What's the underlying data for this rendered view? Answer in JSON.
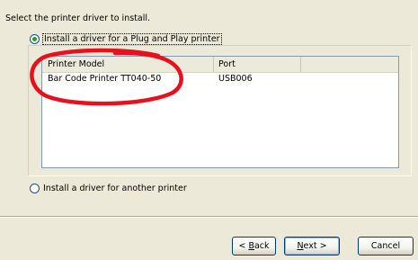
{
  "instruction": "Select the printer driver to install.",
  "options": {
    "plug_and_play": {
      "label": "Install a driver for a Plug and Play printer",
      "selected": true
    },
    "another": {
      "label": "Install a driver for another printer",
      "selected": false
    }
  },
  "printer_list": {
    "columns": [
      "Printer Model",
      "Port",
      ""
    ],
    "rows": [
      {
        "model": "Bar Code Printer TT040-50",
        "port": "USB006"
      }
    ]
  },
  "buttons": {
    "back": {
      "prefix": "< ",
      "underline": "B",
      "rest": "ack"
    },
    "next": {
      "underline": "N",
      "rest": "ext >"
    },
    "cancel": {
      "label": "Cancel"
    }
  },
  "colors": {
    "dialog_bg": "#ece9d8",
    "annotation": "#e8101c",
    "radio_dot": "#21a121"
  }
}
